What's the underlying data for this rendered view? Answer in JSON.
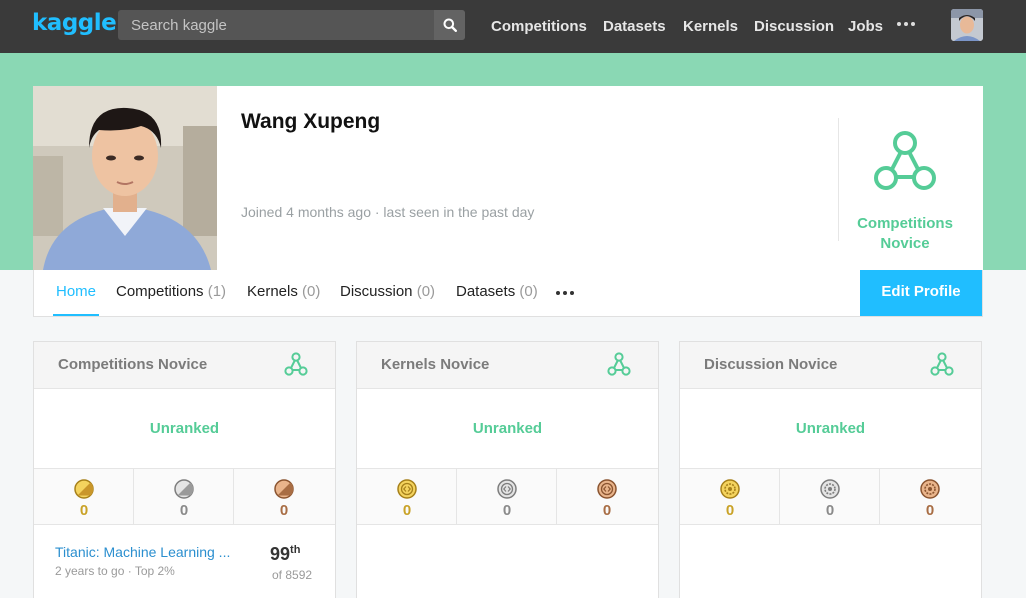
{
  "nav": {
    "logo": "kaggle",
    "search_placeholder": "Search kaggle",
    "links": [
      "Competitions",
      "Datasets",
      "Kernels",
      "Discussion",
      "Jobs"
    ]
  },
  "profile": {
    "name": "Wang Xupeng",
    "joined": "Joined 4 months ago · last seen in the past day",
    "tier_line1": "Competitions",
    "tier_line2": "Novice"
  },
  "tabs": [
    {
      "label": "Home",
      "count": ""
    },
    {
      "label": "Competitions",
      "count": "(1)"
    },
    {
      "label": "Kernels",
      "count": "(0)"
    },
    {
      "label": "Discussion",
      "count": "(0)"
    },
    {
      "label": "Datasets",
      "count": "(0)"
    }
  ],
  "edit_profile": "Edit Profile",
  "cards": [
    {
      "title": "Competitions Novice",
      "rank_text": "Unranked",
      "medals": {
        "gold": "0",
        "silver": "0",
        "bronze": "0"
      },
      "entry": {
        "name": "Titanic: Machine Learning ...",
        "meta": "2 years to go · Top 2%",
        "rank": "99",
        "rank_suffix": "th",
        "of": "of 8592"
      }
    },
    {
      "title": "Kernels Novice",
      "rank_text": "Unranked",
      "medals": {
        "gold": "0",
        "silver": "0",
        "bronze": "0"
      }
    },
    {
      "title": "Discussion Novice",
      "rank_text": "Unranked",
      "medals": {
        "gold": "0",
        "silver": "0",
        "bronze": "0"
      }
    }
  ],
  "colors": {
    "brand": "#20beff",
    "tier_green": "#55cc97",
    "band": "#8ad8b4",
    "gold": "#c9a227",
    "silver": "#8a8a8a",
    "bronze": "#a86d44"
  }
}
